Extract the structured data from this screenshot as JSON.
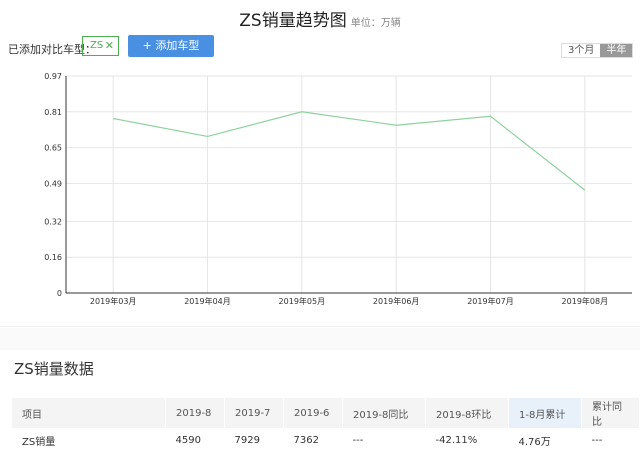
{
  "header": {
    "title": "ZS销量趋势图",
    "unit": "单位：万辆"
  },
  "compare": {
    "label": "已添加对比车型：",
    "tag": "ZS",
    "add_button": "+ 添加车型"
  },
  "range_toggle": {
    "options": [
      "3个月",
      "半年"
    ],
    "selected": "半年"
  },
  "chart_data": {
    "type": "line",
    "categories": [
      "2019年03月",
      "2019年04月",
      "2019年05月",
      "2019年06月",
      "2019年07月",
      "2019年08月"
    ],
    "values": [
      0.78,
      0.7,
      0.81,
      0.75,
      0.79,
      0.46
    ],
    "ylim": [
      0,
      0.97
    ],
    "yticks": [
      "0",
      "0.16",
      "0.32",
      "0.49",
      "0.65",
      "0.81",
      "0.97"
    ],
    "line_color": "#8fd19e",
    "grid": true
  },
  "section": {
    "title": "ZS销量数据"
  },
  "table": {
    "headers": [
      "项目",
      "2019-8",
      "2019-7",
      "2019-6",
      "2019-8同比",
      "2019-8环比",
      "1-8月累计",
      "累计同比"
    ],
    "rows": [
      [
        "ZS销量",
        "4590",
        "7929",
        "7362",
        "---",
        "-42.11%",
        "4.76万",
        "---"
      ]
    ]
  }
}
